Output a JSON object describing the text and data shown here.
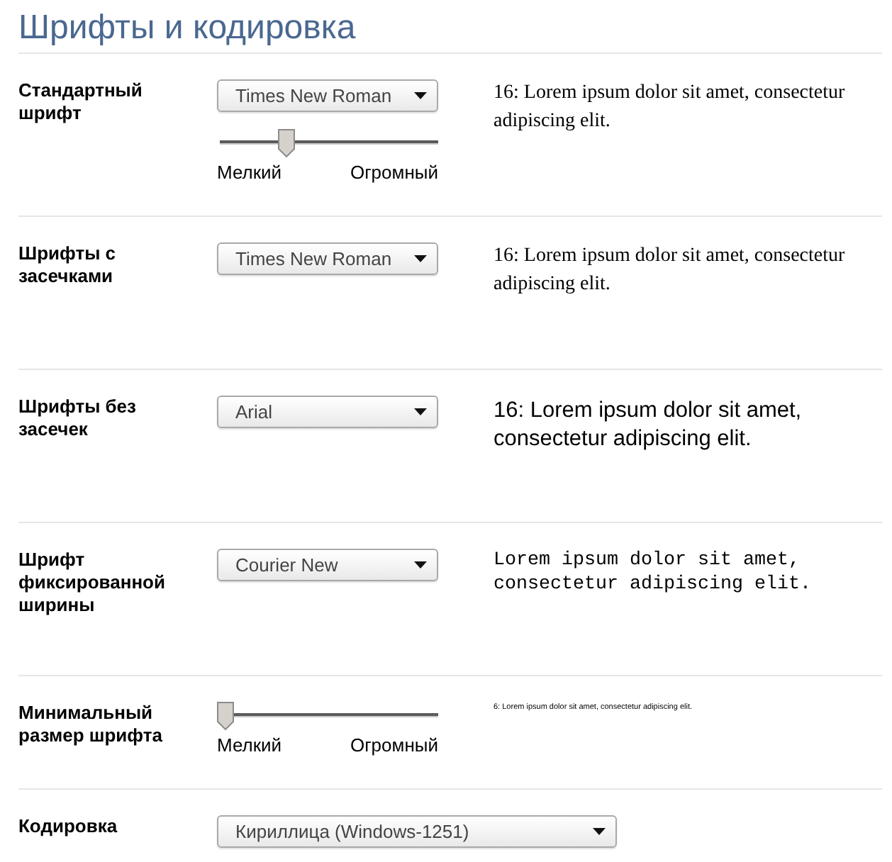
{
  "title": "Шрифты и кодировка",
  "sections": [
    {
      "kind": "font",
      "label": "Стандартный шрифт",
      "select": {
        "value": "Times New Roman"
      },
      "slider": {
        "level": 0.3,
        "min_label": "Мелкий",
        "max_label": "Огромный"
      },
      "sample": {
        "kind": "serif",
        "text": "16: Lorem ipsum dolor sit amet, consectetur adipiscing elit."
      }
    },
    {
      "kind": "font",
      "label": "Шрифты с засечками",
      "select": {
        "value": "Times New Roman"
      },
      "sample": {
        "kind": "serif",
        "text": "16: Lorem ipsum dolor sit amet, consectetur adipiscing elit."
      }
    },
    {
      "kind": "font",
      "label": "Шрифты без засечек",
      "select": {
        "value": "Arial"
      },
      "sample": {
        "kind": "sans",
        "text": "16: Lorem ipsum dolor sit amet, consectetur adipiscing elit."
      }
    },
    {
      "kind": "font",
      "label": "Шрифт фиксированной ширины",
      "select": {
        "value": "Courier New"
      },
      "sample": {
        "kind": "mono",
        "text": "Lorem ipsum dolor sit amet, consectetur adipiscing elit."
      }
    },
    {
      "kind": "minimum",
      "label": "Минимальный размер шрифта",
      "slider": {
        "level": 0,
        "min_label": "Мелкий",
        "max_label": "Огромный"
      },
      "sample": {
        "kind": "tiny",
        "text": "6: Lorem ipsum dolor sit amet, consectetur adipiscing elit."
      }
    },
    {
      "kind": "encoding",
      "label": "Кодировка",
      "select": {
        "value": "Кириллица (Windows-1251)"
      }
    }
  ]
}
